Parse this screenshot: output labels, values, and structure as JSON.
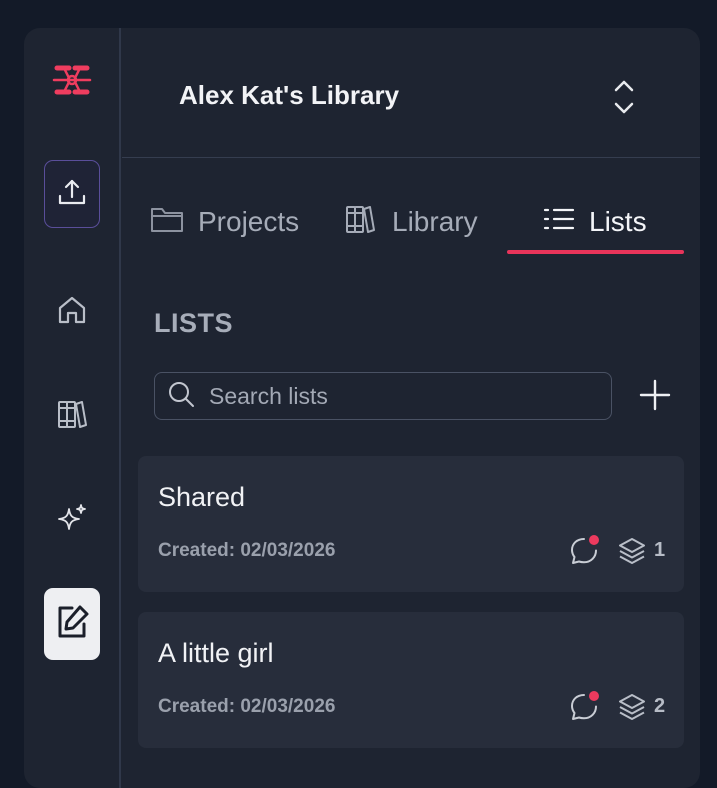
{
  "rail": {
    "items": [
      {
        "icon": "upload-icon"
      },
      {
        "icon": "home-icon"
      },
      {
        "icon": "books-icon"
      },
      {
        "icon": "sparkles-icon"
      },
      {
        "icon": "edit-note-icon"
      }
    ]
  },
  "header": {
    "library_name": "Alex Kat's Library"
  },
  "tabs": [
    {
      "label": "Projects",
      "icon": "folder-icon"
    },
    {
      "label": "Library",
      "icon": "books-icon"
    },
    {
      "label": "Lists",
      "icon": "list-icon",
      "active": true
    }
  ],
  "lists_section": {
    "heading": "LISTS",
    "search_placeholder": "Search lists",
    "search_value": ""
  },
  "lists": [
    {
      "name": "Shared",
      "created": "Created: 02/03/2026",
      "count": "1"
    },
    {
      "name": "A little girl",
      "created": "Created: 02/03/2026",
      "count": "2"
    }
  ],
  "colors": {
    "accent": "#e8345a",
    "background": "#1e2431",
    "card": "#272d3b"
  }
}
